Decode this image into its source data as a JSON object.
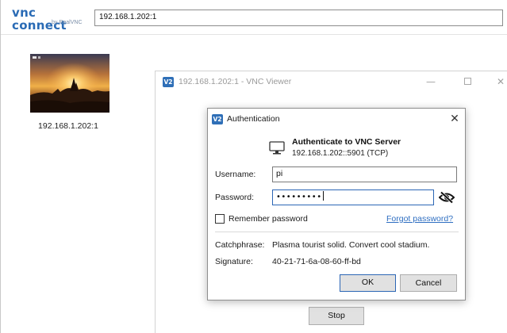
{
  "connect": {
    "logo_main": "vnc connect",
    "logo_sub": "by RealVNC",
    "address": "192.168.1.202:1",
    "computer": {
      "label": "192.168.1.202:1"
    }
  },
  "viewer": {
    "title": "192.168.1.202:1 - VNC Viewer",
    "icon_badge": "V2",
    "stop_label": "Stop"
  },
  "auth": {
    "icon_badge": "V2",
    "title": "Authentication",
    "close_glyph": "✕",
    "server_title": "Authenticate to VNC Server",
    "server_address": "192.168.1.202::5901 (TCP)",
    "username_label": "Username:",
    "username_value": "pi",
    "password_label": "Password:",
    "password_masked": "•••••••••",
    "remember_label": "Remember password",
    "remember_checked": false,
    "forgot_label": "Forgot password?",
    "catchphrase_label": "Catchphrase:",
    "catchphrase_value": "Plasma tourist solid. Convert cool stadium.",
    "signature_label": "Signature:",
    "signature_value": "40-21-71-6a-08-60-ff-bd",
    "ok_label": "OK",
    "cancel_label": "Cancel"
  },
  "colors": {
    "brand": "#2a6bb5",
    "link": "#2e6ec1",
    "focus": "#2c66b5",
    "button_face": "#e1e1e1"
  },
  "icons": {
    "monitor": "monitor-icon",
    "eye": "eye-slash-icon",
    "close": "close-icon"
  }
}
